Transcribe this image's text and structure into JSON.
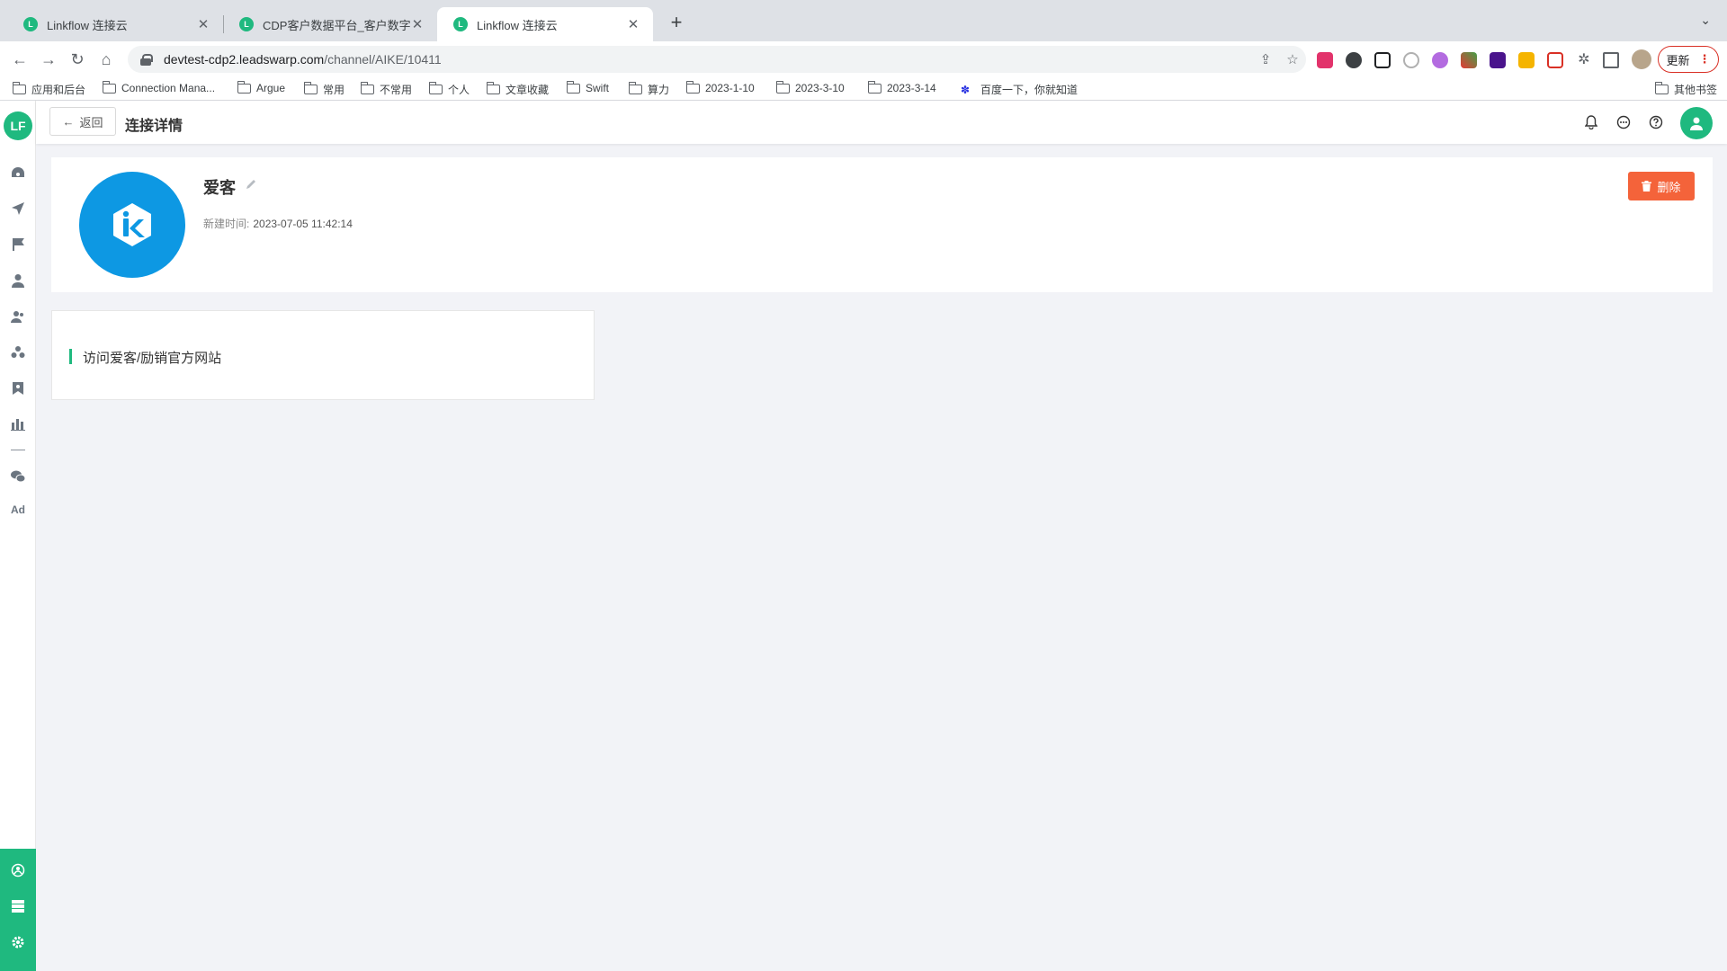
{
  "browser": {
    "tabs": [
      {
        "title": "Linkflow 连接云",
        "active": false
      },
      {
        "title": "CDP客户数据平台_客户数字化全",
        "active": false
      },
      {
        "title": "Linkflow 连接云",
        "active": true
      }
    ],
    "url_host": "devtest-cdp2.leadswarp.com",
    "url_path": "/channel/AIKE/10411",
    "update_label": "更新",
    "bookmarks": [
      "应用和后台",
      "Connection Mana...",
      "Argue",
      "常用",
      "不常用",
      "个人",
      "文章收藏",
      "Swift",
      "算力",
      "2023-1-10",
      "2023-3-10",
      "2023-3-14"
    ],
    "bookmark_baidu": "百度一下，你就知道",
    "bookmark_other": "其他书签"
  },
  "app": {
    "logo_text": "LF",
    "header": {
      "back_label": "返回",
      "title": "连接详情"
    },
    "sidebar": {
      "ad_label": "Ad",
      "icons": [
        "dashboard-icon",
        "send-icon",
        "flag-icon",
        "user-icon",
        "users-icon",
        "group-icon",
        "bookmark-icon",
        "bar-chart-icon",
        "wechat-icon"
      ],
      "bottom_icons": [
        "connect-icon",
        "database-icon",
        "settings-icon"
      ]
    },
    "connection": {
      "name": "爱客",
      "created_label": "新建时间:",
      "created_value": "2023-07-05 11:42:14",
      "delete_label": "删除"
    },
    "link_card": {
      "text": "访问爱客/励销官方网站"
    },
    "colors": {
      "brand": "#1fb97f",
      "danger": "#f4633a",
      "aike_blue": "#0d98e3"
    }
  }
}
